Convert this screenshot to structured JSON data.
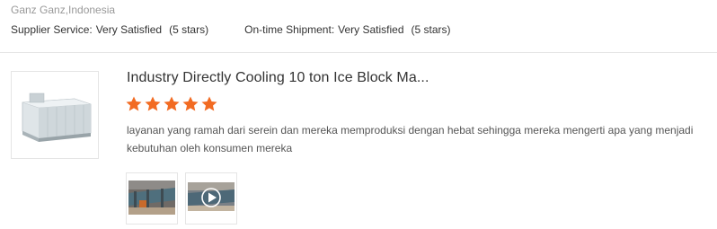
{
  "reviewer": {
    "name_location": "Ganz Ganz,Indonesia"
  },
  "ratings": [
    {
      "label": "Supplier Service:",
      "value": "Very Satisfied",
      "stars_text": "(5 stars)",
      "stars": 5
    },
    {
      "label": "On-time Shipment:",
      "value": "Very Satisfied",
      "stars_text": "(5 stars)",
      "stars": 5
    }
  ],
  "product": {
    "title": "Industry Directly Cooling 10 ton Ice Block Ma...",
    "rating": 5,
    "review": "layanan yang ramah dari serein dan mereka memproduksi dengan hebat sehingga mereka mengerti apa yang menjadi kebutuhan oleh konsumen mereka",
    "thumbnail_icon": "ice-block-machine-image"
  },
  "attachments": [
    {
      "icon": "factory-photo-image"
    },
    {
      "icon": "video-play-thumbnail"
    }
  ],
  "colors": {
    "star": "#f26b22",
    "divider": "#e5e5e5",
    "muted_text": "#999999"
  }
}
